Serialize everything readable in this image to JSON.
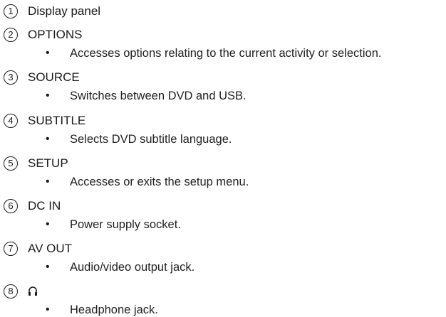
{
  "items": [
    {
      "num": "1",
      "title": "Display panel"
    },
    {
      "num": "2",
      "title": "OPTIONS",
      "bullet": "•",
      "desc": "Accesses options relating to the current activity or selection."
    },
    {
      "num": "3",
      "title": "SOURCE",
      "bullet": "•",
      "desc": "Switches between DVD and USB."
    },
    {
      "num": "4",
      "title": "SUBTITLE",
      "bullet": "•",
      "desc": "Selects DVD subtitle language."
    },
    {
      "num": "5",
      "title": "SETUP",
      "bullet": "•",
      "desc": "Accesses or exits the setup menu."
    },
    {
      "num": "6",
      "title": "DC IN",
      "bullet": "•",
      "desc": "Power supply socket."
    },
    {
      "num": "7",
      "title": "AV OUT",
      "bullet": "•",
      "desc": "Audio/video output jack."
    },
    {
      "num": "8",
      "icon": "headphone-icon",
      "bullet": "•",
      "desc": "Headphone jack."
    }
  ]
}
